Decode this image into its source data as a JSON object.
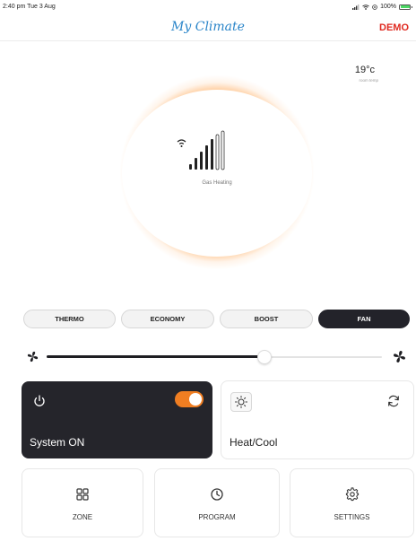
{
  "status_bar": {
    "time": "2:40 pm  Tue 3 Aug",
    "battery": "100%"
  },
  "header": {
    "title": "My Climate",
    "demo": "DEMO"
  },
  "climate": {
    "mode_label": "Gas Heating",
    "temperature": "19°c",
    "temperature_label": "room temp"
  },
  "modes": [
    {
      "label": "THERMO",
      "active": false
    },
    {
      "label": "ECONOMY",
      "active": false
    },
    {
      "label": "BOOST",
      "active": false
    },
    {
      "label": "FAN",
      "active": true
    }
  ],
  "fan_speed": {
    "fraction": 0.65
  },
  "system_card": {
    "label": "System ON",
    "toggle_on": true
  },
  "heat_cool_card": {
    "label": "Heat/Cool"
  },
  "nav": [
    {
      "label": "ZONE",
      "icon": "grid-icon"
    },
    {
      "label": "PROGRAM",
      "icon": "clock-icon"
    },
    {
      "label": "SETTINGS",
      "icon": "gear-icon"
    }
  ],
  "colors": {
    "accent": "#f07e22",
    "brand": "#2a85c9",
    "demo": "#e02a20",
    "dark_card": "#25252b"
  }
}
